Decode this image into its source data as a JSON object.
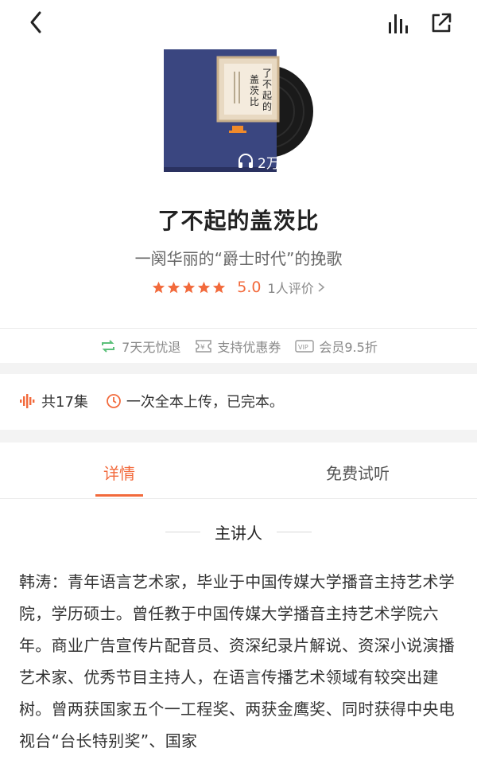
{
  "header": {
    "back_icon": "chevron-left-icon",
    "chart_icon": "bar-chart-icon",
    "share_icon": "share-icon"
  },
  "cover": {
    "book_title": "了不起的盖茨比",
    "play_count": "2万",
    "headphones_icon": "headphones-icon"
  },
  "album": {
    "title": "了不起的盖茨比",
    "subtitle": "一阕华丽的“爵士时代”的挽歌",
    "rating": 5.0,
    "score": "5.0",
    "reviews": "1人评价"
  },
  "perks": [
    {
      "label": "7天无忧退",
      "icon": "refresh-icon",
      "color": "#5cc07a"
    },
    {
      "label": "支持优惠券",
      "icon": "coupon-icon",
      "color": "#999999"
    },
    {
      "label": "会员9.5折",
      "icon": "vip-icon",
      "color": "#999999"
    }
  ],
  "info": {
    "episodes": "共17集",
    "status": "一次全本上传，已完本。"
  },
  "tabs": [
    {
      "label": "详情",
      "active": true
    },
    {
      "label": "免费试听",
      "active": false
    }
  ],
  "section": {
    "heading": "主讲人",
    "paragraph": "韩涛：青年语言艺术家，毕业于中国传媒大学播音主持艺术学院，学历硕士。曾任教于中国传媒大学播音主持艺术学院六年。商业广告宣传片配音员、资深纪录片解说、资深小说演播艺术家、优秀节目主持人，在语言传播艺术领域有较突出建树。曾两获国家五个一工程奖、两获金鹰奖、同时获得中央电视台“台长特别奖”、国家"
  },
  "colors": {
    "accent": "#f26a3c",
    "cover_blue": "#3a4680"
  }
}
